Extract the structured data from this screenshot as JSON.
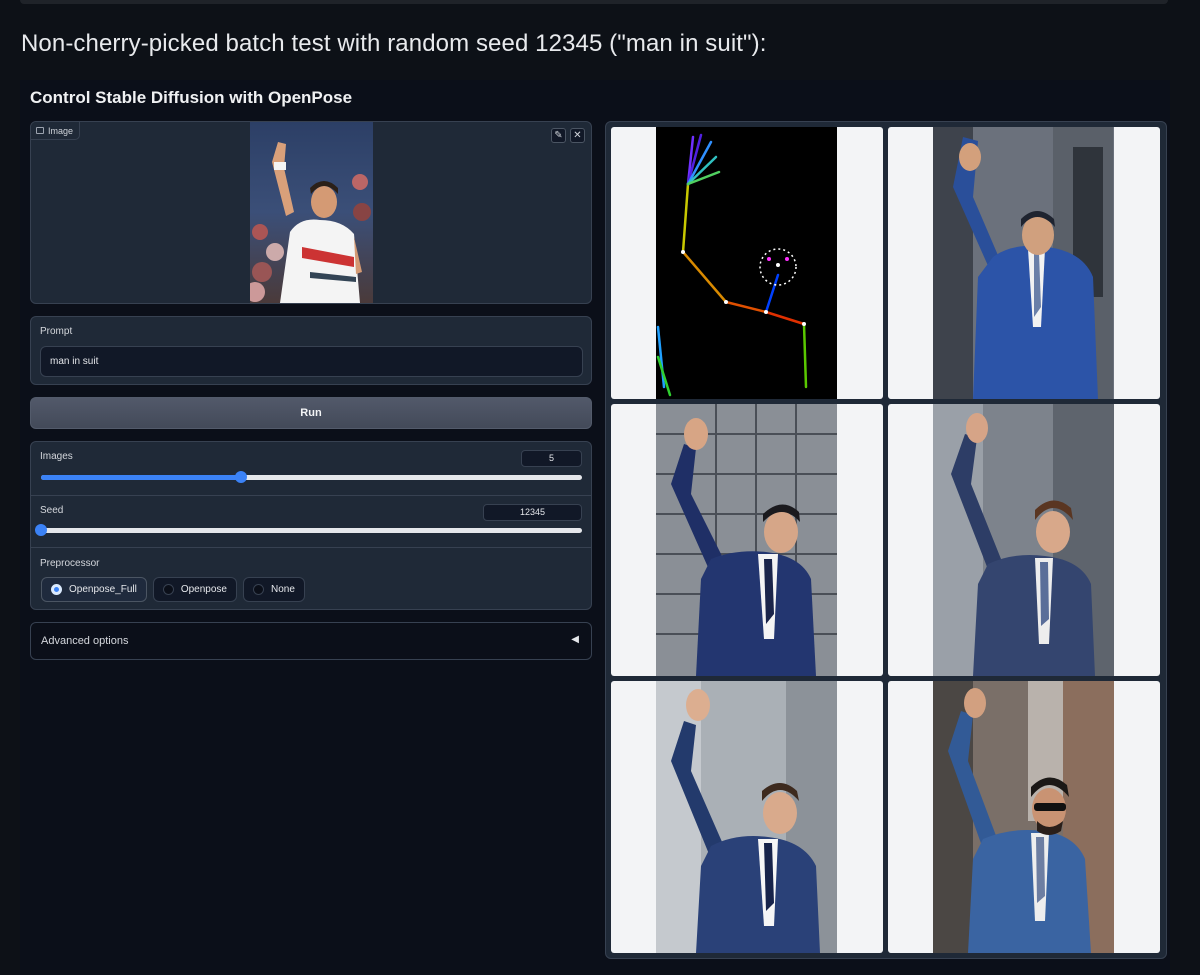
{
  "page": {
    "heading": "Non-cherry-picked batch test with random seed 12345 (\"man in suit\"):"
  },
  "app": {
    "title": "Control Stable Diffusion with OpenPose",
    "image_input": {
      "label": "Image",
      "edit_icon": "pencil-icon",
      "clear_icon": "close-icon"
    },
    "prompt": {
      "label": "Prompt",
      "value": "man in suit"
    },
    "run_label": "Run",
    "images_slider": {
      "label": "Images",
      "value": "5",
      "fraction": 0.37
    },
    "seed_slider": {
      "label": "Seed",
      "value": "12345",
      "fraction": 0.0
    },
    "preprocessor": {
      "label": "Preprocessor",
      "options": [
        "Openpose_Full",
        "Openpose",
        "None"
      ],
      "selected": "Openpose_Full"
    },
    "advanced_label": "Advanced options",
    "advanced_arrow": "◀"
  },
  "gallery": {
    "items": [
      "openpose-skeleton-map",
      "man-in-blue-suit-waving-1",
      "man-in-blue-suit-waving-2",
      "man-in-blue-suit-waving-3",
      "man-in-blue-suit-waving-4",
      "man-in-blue-suit-waving-sunglasses"
    ]
  },
  "colors": {
    "accent": "#3b82f6",
    "panel": "#1f2937",
    "border": "#374151",
    "background": "#0b0f19"
  }
}
